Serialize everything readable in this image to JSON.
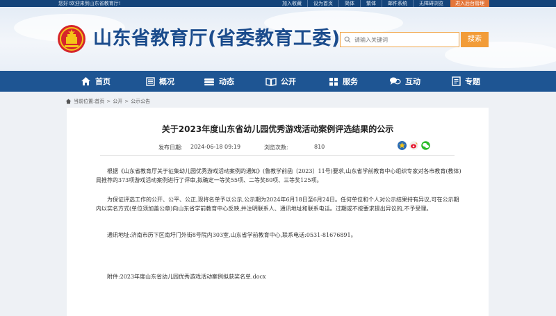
{
  "topbar": {
    "welcome": "您好!欢迎来到山东省教育厅!",
    "links": [
      "加入收藏",
      "设为首页",
      "简体",
      "繁体",
      "邮件系统",
      "无障碍浏览"
    ],
    "admin_button": "进入后台管理"
  },
  "header": {
    "site_title": "山东省教育厅(省委教育工委)",
    "search_placeholder": "请输入关键词",
    "search_button": "搜索"
  },
  "nav": {
    "items": [
      {
        "label": "首页",
        "icon": "home-icon"
      },
      {
        "label": "概况",
        "icon": "overview-icon"
      },
      {
        "label": "动态",
        "icon": "news-icon"
      },
      {
        "label": "公开",
        "icon": "book-icon"
      },
      {
        "label": "服务",
        "icon": "service-icon"
      },
      {
        "label": "互动",
        "icon": "chat-icon"
      },
      {
        "label": "专题",
        "icon": "topic-icon"
      }
    ]
  },
  "breadcrumb": {
    "prefix": "当前位置:",
    "items": [
      "首页",
      "公开",
      "公示公告"
    ]
  },
  "article": {
    "title": "关于2023年度山东省幼儿园优秀游戏活动案例评选结果的公示",
    "published_label": "发布日期:",
    "published_value": "2024-06-18 09:19",
    "views_label": "浏览次数:",
    "views_value": "810",
    "paragraph_1": "根据《山东省教育厅关于征集幼儿园优秀游戏活动案例的通知》(鲁教学前函〔2023〕11号)要求,山东省学前教育中心组织专家对各市教育(教体)局推荐的373项游戏活动案例进行了评审,拟确定一等奖55项、二等奖80项、三等奖125项。",
    "paragraph_2": "为保证评选工作的公开、公平、公正,现将名单予以公示,公示期为2024年6月18日至6月24日。任何单位和个人对公示结果持有异议,可在公示期内以实名方式(单位须加盖公章)向山东省学前教育中心反映,并注明联系人、通讯地址和联系电话。过期或不按要求提出异议的,不予受理。",
    "paragraph_3": "通讯地址:济南市历下区南圩门外街8号院内303室,山东省学前教育中心,联系电话:0531-81676891。",
    "attachment": "附件:2023年度山东省幼儿园优秀游戏活动案例拟获奖名单.docx"
  },
  "colors": {
    "brand_blue": "#1e5593",
    "topbar_blue": "#14447a",
    "accent_orange": "#f29c38",
    "title_blue": "#1a4b8c"
  }
}
